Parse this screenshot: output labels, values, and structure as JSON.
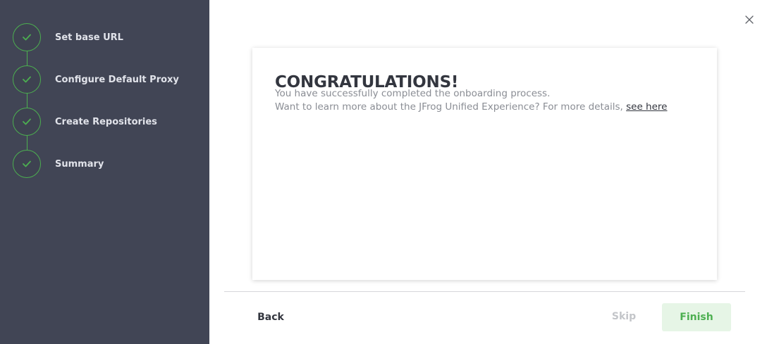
{
  "wizard": {
    "steps": [
      {
        "label": "Set base URL",
        "status": "completed",
        "icon": "check-icon"
      },
      {
        "label": "Configure Default Proxy",
        "status": "completed",
        "icon": "check-icon"
      },
      {
        "label": "Create Repositories",
        "status": "completed",
        "icon": "check-icon"
      },
      {
        "label": "Summary",
        "status": "completed",
        "icon": "check-icon"
      }
    ]
  },
  "card": {
    "title": "CONGRATULATIONS!",
    "line1": "You have successfully completed the onboarding process.",
    "line2_prefix": "Want to learn more about the JFrog Unified Experience? For more details, ",
    "link_label": "see here"
  },
  "footer": {
    "back_label": "Back",
    "skip_label": "Skip",
    "finish_label": "Finish"
  },
  "colors": {
    "sidebar_bg": "#414555",
    "accent_green": "#4caf50",
    "finish_bg": "#e6f5e6"
  },
  "icons": {
    "close": "close-icon",
    "step": "check-icon"
  }
}
